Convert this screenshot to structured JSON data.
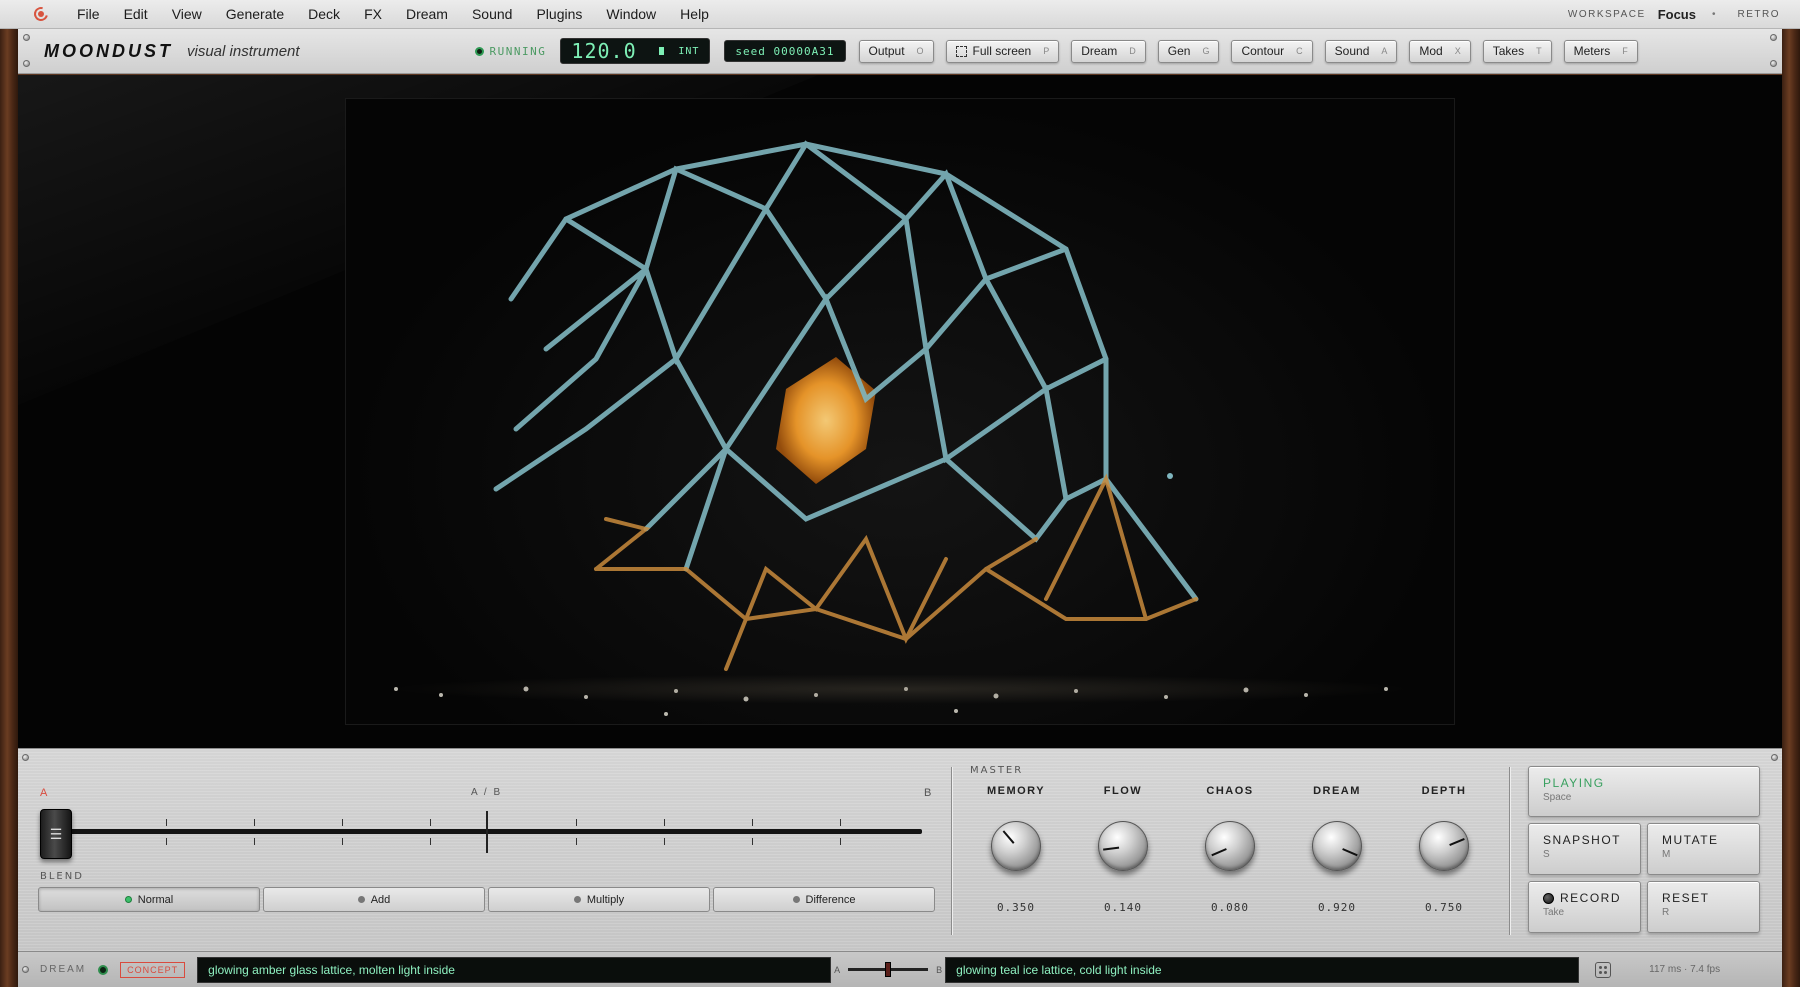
{
  "menubar": {
    "items": [
      "File",
      "Edit",
      "View",
      "Generate",
      "Deck",
      "FX",
      "Dream",
      "Sound",
      "Plugins",
      "Window",
      "Help"
    ],
    "workspace_label": "WORKSPACE",
    "workspace_value": "Focus",
    "workspace_dot": "•",
    "retro": "RETRO"
  },
  "header": {
    "brand": "MOONDUST",
    "brand_sub": "visual instrument",
    "status": "RUNNING",
    "bpm": "120.0",
    "bpm_mode": "INT",
    "seed": "seed 00000A31",
    "buttons": [
      {
        "label": "Output",
        "key": "O"
      },
      {
        "label": "Full screen",
        "key": "P"
      },
      {
        "label": "Dream",
        "key": "D"
      },
      {
        "label": "Gen",
        "key": "G"
      },
      {
        "label": "Contour",
        "key": "C"
      },
      {
        "label": "Sound",
        "key": "A"
      },
      {
        "label": "Mod",
        "key": "X"
      },
      {
        "label": "Takes",
        "key": "T"
      },
      {
        "label": "Meters",
        "key": "F"
      }
    ]
  },
  "crossfader": {
    "a": "A",
    "ab": "A / B",
    "b": "B",
    "position": 0.0,
    "thumb_glyph": "☰"
  },
  "blend": {
    "label": "BLEND",
    "modes": [
      "Normal",
      "Add",
      "Multiply",
      "Difference"
    ],
    "active": "Normal"
  },
  "master": {
    "label": "MASTER",
    "knobs": [
      {
        "name": "MEMORY",
        "value": "0.350"
      },
      {
        "name": "FLOW",
        "value": "0.140"
      },
      {
        "name": "CHAOS",
        "value": "0.080"
      },
      {
        "name": "DREAM",
        "value": "0.920"
      },
      {
        "name": "DEPTH",
        "value": "0.750"
      }
    ]
  },
  "transport": {
    "playing": {
      "label": "PLAYING",
      "key": "Space"
    },
    "snapshot": {
      "label": "SNAPSHOT",
      "key": "S"
    },
    "mutate": {
      "label": "MUTATE",
      "key": "M"
    },
    "record": {
      "label": "RECORD",
      "key": "Take"
    },
    "reset": {
      "label": "RESET",
      "key": "R"
    }
  },
  "dreambar": {
    "label": "DREAM",
    "tag": "CONCEPT",
    "prompt_a": "glowing amber glass lattice, molten light inside",
    "prompt_b": "glowing teal ice lattice, cold light inside",
    "mini_a": "A",
    "mini_b": "B",
    "mini_position": 0.5,
    "stats": "117 ms · 7.4 fps"
  },
  "colors": {
    "accent_green": "#3aa060",
    "accent_red": "#d94b3e",
    "lcd_text": "#7ef0b6",
    "lattice_teal": "#7fb6bf",
    "lattice_amber": "#f09a2a"
  }
}
